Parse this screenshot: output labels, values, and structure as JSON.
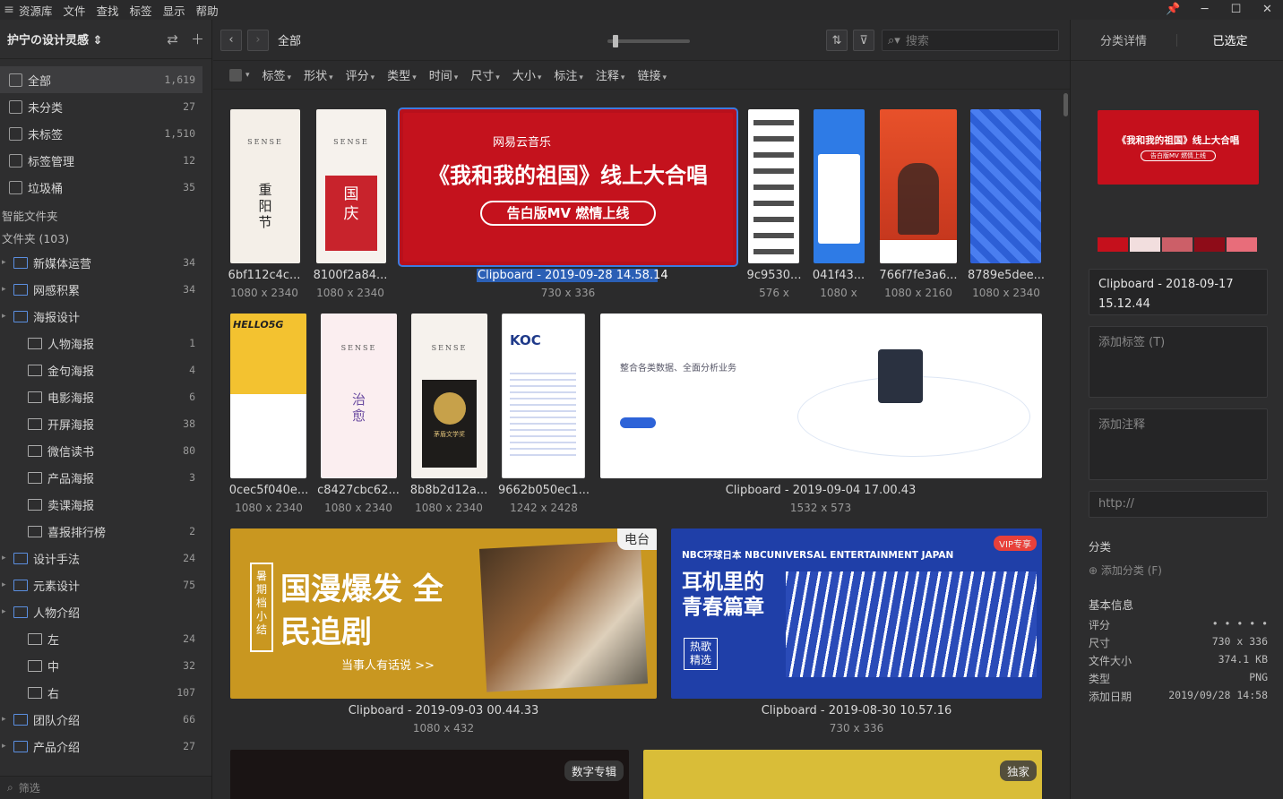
{
  "menubar": {
    "items": [
      "资源库",
      "文件",
      "查找",
      "标签",
      "显示",
      "帮助"
    ]
  },
  "sidebar": {
    "library_name": "护宁の设计灵感 ⇕",
    "main_items": [
      {
        "label": "全部",
        "count": "1,619",
        "icon": "all-icon"
      },
      {
        "label": "未分类",
        "count": "27",
        "icon": "uncategorized-icon"
      },
      {
        "label": "未标签",
        "count": "1,510",
        "icon": "untagged-icon"
      },
      {
        "label": "标签管理",
        "count": "12",
        "icon": "tag-manage-icon"
      },
      {
        "label": "垃圾桶",
        "count": "35",
        "icon": "trash-icon"
      }
    ],
    "smart_folders_label": "智能文件夹",
    "folders_label": "文件夹 (103)",
    "folders": [
      {
        "label": "新媒体运营",
        "count": "34",
        "level": 0
      },
      {
        "label": "网感积累",
        "count": "34",
        "level": 0
      },
      {
        "label": "海报设计",
        "count": "",
        "level": 0
      },
      {
        "label": "人物海报",
        "count": "1",
        "level": 1
      },
      {
        "label": "金句海报",
        "count": "4",
        "level": 1
      },
      {
        "label": "电影海报",
        "count": "6",
        "level": 1
      },
      {
        "label": "开屏海报",
        "count": "38",
        "level": 1
      },
      {
        "label": "微信读书",
        "count": "80",
        "level": 1
      },
      {
        "label": "产品海报",
        "count": "3",
        "level": 1
      },
      {
        "label": "卖课海报",
        "count": "",
        "level": 1
      },
      {
        "label": "喜报排行榜",
        "count": "2",
        "level": 1
      },
      {
        "label": "设计手法",
        "count": "24",
        "level": 0
      },
      {
        "label": "元素设计",
        "count": "75",
        "level": 0
      },
      {
        "label": "人物介绍",
        "count": "",
        "level": 0
      },
      {
        "label": "左",
        "count": "24",
        "level": 1
      },
      {
        "label": "中",
        "count": "32",
        "level": 1
      },
      {
        "label": "右",
        "count": "107",
        "level": 1
      },
      {
        "label": "团队介绍",
        "count": "66",
        "level": 0
      },
      {
        "label": "产品介绍",
        "count": "27",
        "level": 0
      }
    ],
    "filter_placeholder": "筛选"
  },
  "toolbar": {
    "breadcrumb": "全部",
    "search_placeholder": "搜索"
  },
  "filters": [
    "标签",
    "形状",
    "评分",
    "类型",
    "时间",
    "尺寸",
    "大小",
    "标注",
    "注释",
    "链接"
  ],
  "grid": {
    "row1": [
      {
        "name": "6bf112c4c...",
        "dim": "1080 x 2340"
      },
      {
        "name": "8100f2a84...",
        "dim": "1080 x 2340"
      },
      {
        "name": "Clipboard - 2019-09-28 14.58.14",
        "dim": "730 x 336"
      },
      {
        "name": "9c9530...",
        "dim": "576 x"
      },
      {
        "name": "041f43...",
        "dim": "1080 x"
      },
      {
        "name": "766f7fe3a6...",
        "dim": "1080 x 2160"
      },
      {
        "name": "8789e5dee...",
        "dim": "1080 x 2340"
      }
    ],
    "row2": [
      {
        "name": "0cec5f040e...",
        "dim": "1080 x 2340"
      },
      {
        "name": "c8427cbc62...",
        "dim": "1080 x 2340"
      },
      {
        "name": "8b8b2d12a...",
        "dim": "1080 x 2340"
      },
      {
        "name": "9662b050ec1...",
        "dim": "1242 x 2428"
      },
      {
        "name": "Clipboard - 2019-09-04 17.00.43",
        "dim": "1532 x 573"
      }
    ],
    "row3": [
      {
        "name": "Clipboard - 2019-09-03 00.44.33",
        "dim": "1080 x 432"
      },
      {
        "name": "Clipboard - 2019-08-30 10.57.16",
        "dim": "730 x 336"
      }
    ],
    "badges": {
      "radio": "电台",
      "album": "数字专辑",
      "exclusive": "独家",
      "vip": "VIP专享"
    },
    "thumb_texts": {
      "banner_brand": "网易云音乐",
      "banner_title": "《我和我的祖国》线上大合唱",
      "banner_sub": "告白版MV 燃情上线",
      "poster1_brand": "SENSE",
      "poster1_title": "重阳节",
      "poster2_title": "国庆",
      "poster6_title": "治愈",
      "poster7_title": "茅盾文学奖",
      "koc": "KOC",
      "hello5g": "HELLO5G",
      "web_title": "整合各类数据、全面分析业务",
      "comic_title": "国漫爆发 全民追剧",
      "comic_side": "暑期档小结",
      "comic_sub": "当事人有话说 >>",
      "nbc_head": "NBC环球日本 NBCUNIVERSAL ENTERTAINMENT JAPAN",
      "nbc_title": "耳机里的青春篇章",
      "nbc_tag": "热歌精选"
    }
  },
  "right_panel": {
    "tab_detail": "分类详情",
    "tab_selected": "已选定",
    "swatches": [
      "#c5101c",
      "#f2dede",
      "#cc5f68",
      "#8e0c18",
      "#e86d7a"
    ],
    "file_name": "Clipboard - 2018-09-17 15.12.44",
    "tag_placeholder": "添加标签 (T)",
    "note_placeholder": "添加注释",
    "url_placeholder": "http://",
    "category_label": "分类",
    "add_category": "添加分类 (F)",
    "basic_info": "基本信息",
    "info": [
      {
        "k": "评分",
        "v": "• • • • •"
      },
      {
        "k": "尺寸",
        "v": "730 x 336"
      },
      {
        "k": "文件大小",
        "v": "374.1 KB"
      },
      {
        "k": "类型",
        "v": "PNG"
      },
      {
        "k": "添加日期",
        "v": "2019/09/28 14:58"
      }
    ]
  }
}
